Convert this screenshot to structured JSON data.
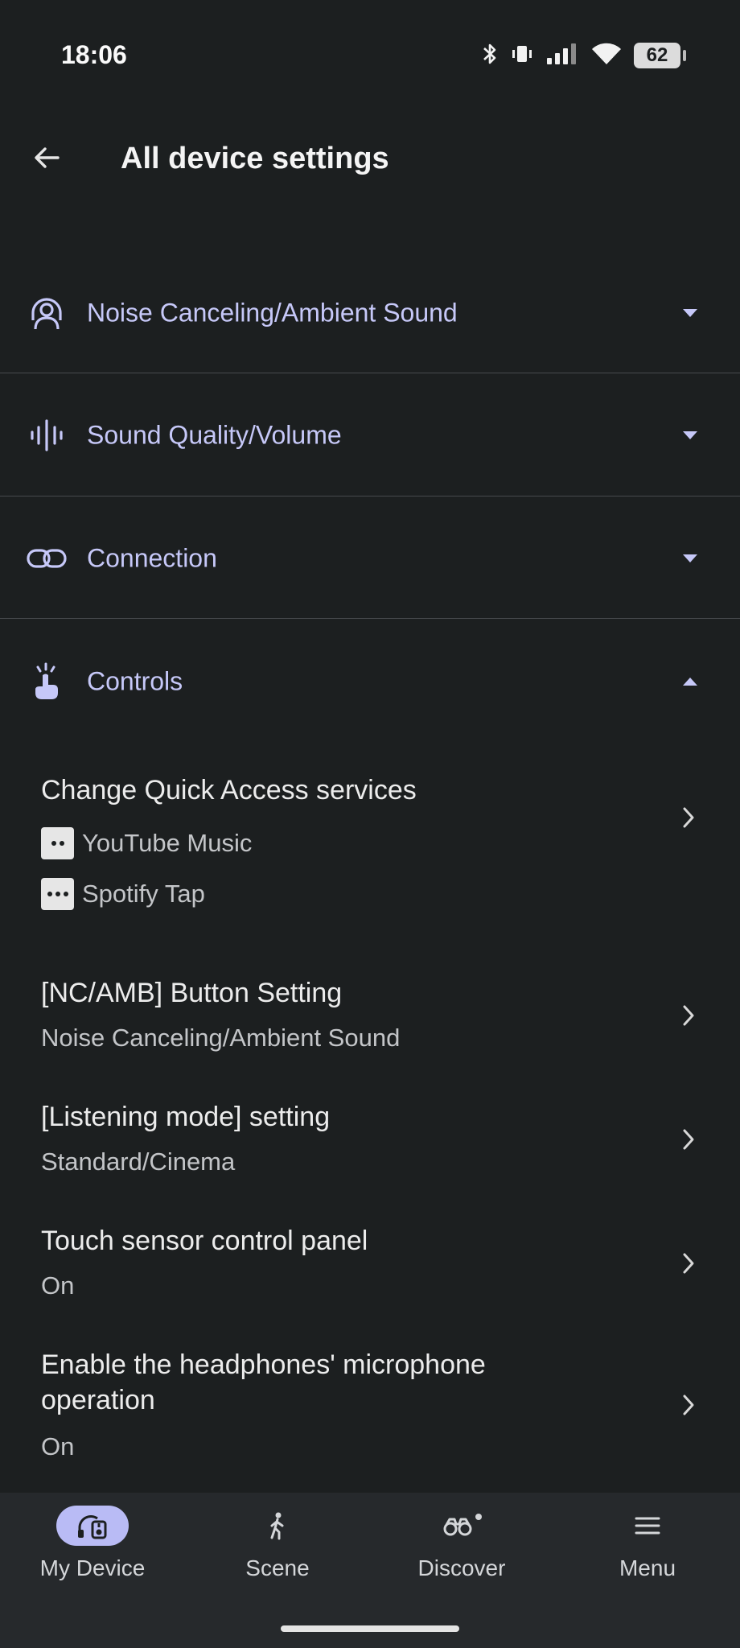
{
  "status_bar": {
    "time": "18:06",
    "battery": "62"
  },
  "header": {
    "title": "All device settings"
  },
  "sections": [
    {
      "label": "Noise Canceling/Ambient Sound",
      "icon": "ambient-sound-icon"
    },
    {
      "label": "Sound Quality/Volume",
      "icon": "sound-wave-icon"
    },
    {
      "label": "Connection",
      "icon": "link-icon"
    },
    {
      "label": "Controls",
      "icon": "touch-control-icon"
    }
  ],
  "controls": {
    "quick_access": {
      "title": "Change Quick Access services",
      "services": [
        {
          "label": "YouTube Music",
          "badge": "two-dot-badge"
        },
        {
          "label": "Spotify Tap",
          "badge": "three-dot-badge"
        }
      ]
    },
    "items": [
      {
        "title": "[NC/AMB] Button Setting",
        "value": "Noise Canceling/Ambient Sound"
      },
      {
        "title": "[Listening mode] setting",
        "value": "Standard/Cinema"
      },
      {
        "title": "Touch sensor control panel",
        "value": "On"
      },
      {
        "title_line1": "Enable the headphones' microphone",
        "title_line2": "operation",
        "value": "On"
      }
    ]
  },
  "bottom_nav": [
    {
      "label": "My Device",
      "active": true
    },
    {
      "label": "Scene",
      "active": false
    },
    {
      "label": "Discover",
      "active": false
    },
    {
      "label": "Menu",
      "active": false
    }
  ],
  "colors": {
    "background": "#1c1f20",
    "accent_text": "#c6c8f8",
    "nav_active": "#b9bbf5",
    "nav_background": "#26292c"
  }
}
